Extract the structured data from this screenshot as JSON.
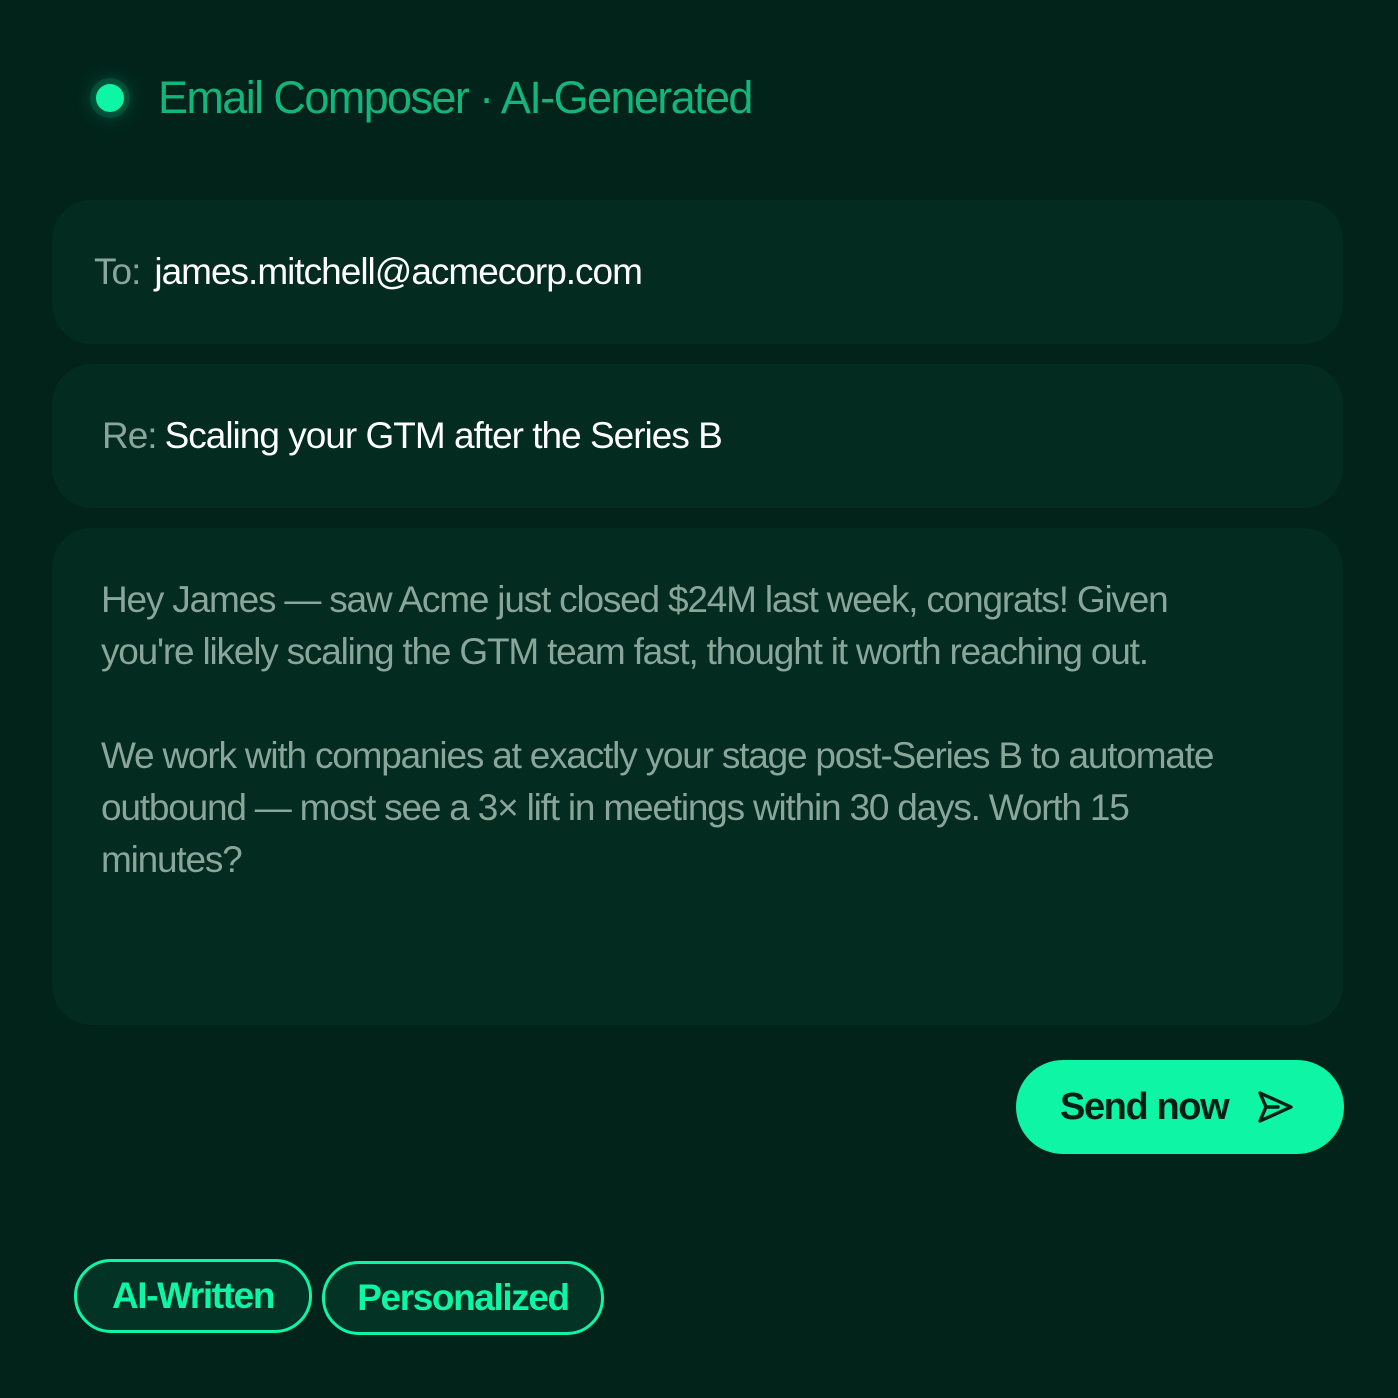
{
  "header": {
    "title": "Email Composer · AI-Generated",
    "status_color": "#0ff5a6"
  },
  "to_field": {
    "label": "To:",
    "value": "james.mitchell@acmecorp.com"
  },
  "subject_field": {
    "label": "Re:",
    "value": "Scaling your GTM after the Series B"
  },
  "body": {
    "paragraphs": [
      "Hey James — saw Acme just closed $24M last week, congrats! Given you're likely scaling the GTM team fast, thought it worth reaching out.",
      "We work with companies at exactly your stage post-Series B to automate outbound — most see a 3× lift in meetings within 30 days. Worth 15 minutes?"
    ]
  },
  "send_button": {
    "label": "Send now",
    "icon": "send-icon"
  },
  "tags": [
    "AI-Written",
    "Personalized"
  ],
  "colors": {
    "background": "#01231a",
    "card": "#032b20",
    "accent": "#0ff5a6",
    "title": "#12b57c"
  }
}
